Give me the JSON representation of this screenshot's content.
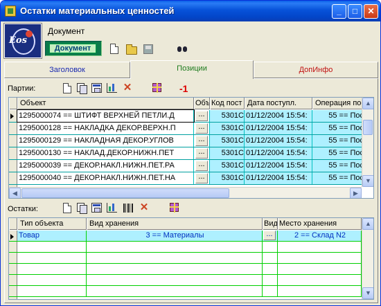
{
  "window": {
    "title": "Остатки материальных ценностей"
  },
  "document": {
    "label": "Документ",
    "badge": "Документ"
  },
  "tabs": [
    {
      "label": "Заголовок"
    },
    {
      "label": "Позиции"
    },
    {
      "label": "ДопИнфо"
    }
  ],
  "parties": {
    "label": "Партии:",
    "counter": "-1",
    "columns": [
      "Объект",
      "Объ",
      "Код пост",
      "Дата поступл.",
      "Операция пос"
    ],
    "rows": [
      {
        "object": "1295000074 == ШТИФТ ВЕРХНЕЙ ПЕТЛИ.Д",
        "obj": "...",
        "code": "5301С",
        "date": "01/12/2004 15:54:",
        "op": "55 == Пос"
      },
      {
        "object": "1295000128 == НАКЛАДКА ДЕКОР.ВЕРХН.П",
        "obj": "...",
        "code": "5301С",
        "date": "01/12/2004 15:54:",
        "op": "55 == Пос"
      },
      {
        "object": "1295000129 == НАКЛАДНАЯ ДЕКОР.УГЛОВ",
        "obj": "...",
        "code": "5301С",
        "date": "01/12/2004 15:54:",
        "op": "55 == Пос"
      },
      {
        "object": "1295000130 == НАКЛАД.ДЕКОР.НИЖН.ПЕТ",
        "obj": "...",
        "code": "5301С",
        "date": "01/12/2004 15:54:",
        "op": "55 == Пос"
      },
      {
        "object": "1295000039 == ДЕКОР.НАКЛ.НИЖН.ПЕТ.РА",
        "obj": "...",
        "code": "5301С",
        "date": "01/12/2004 15:54:",
        "op": "55 == Пос"
      },
      {
        "object": "1295000040 == ДЕКОР.НАКЛ.НИЖН.ПЕТ.НА",
        "obj": "...",
        "code": "5301С",
        "date": "01/12/2004 15:54:",
        "op": "55 == Пос"
      }
    ]
  },
  "remains": {
    "label": "Остатки:",
    "columns": [
      "Тип объекта",
      "Вид хранения",
      "Вид",
      "Место хранения"
    ],
    "rows": [
      {
        "type": "Товар",
        "storage": "3 == Материалы",
        "kind": "...",
        "place": "2 == Склад N2"
      }
    ]
  },
  "icons": [
    "new-document-icon",
    "open-folder-icon",
    "save-disk-icon",
    "binoculars-icon",
    "copy-icon",
    "properties-icon",
    "chart-icon",
    "delete-icon",
    "gift-icon",
    "barcode-icon"
  ],
  "colors": {
    "selection": "#aef0ff",
    "grid_line": "#00c0c0",
    "remains_line": "#00d000",
    "tab_active": "#1c7a1c",
    "tab_blue": "#1a2ab0",
    "tab_red": "#c01010"
  }
}
